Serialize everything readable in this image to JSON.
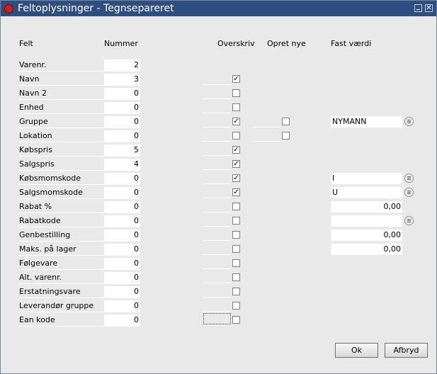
{
  "window": {
    "title": "Feltoplysninger - Tegnsepareret"
  },
  "headers": {
    "felt": "Felt",
    "nummer": "Nummer",
    "overskriv": "Overskriv",
    "opret_nye": "Opret nye",
    "fast_vaerdi": "Fast værdi"
  },
  "rows": [
    {
      "label": "Varenr.",
      "nummer": "2",
      "overskriv": null,
      "opret_nye": null,
      "fast_vaerdi": null,
      "lookup": false
    },
    {
      "label": "Navn",
      "nummer": "3",
      "overskriv": true,
      "opret_nye": null,
      "fast_vaerdi": null,
      "lookup": false
    },
    {
      "label": "Navn 2",
      "nummer": "0",
      "overskriv": false,
      "opret_nye": null,
      "fast_vaerdi": null,
      "lookup": false
    },
    {
      "label": "Enhed",
      "nummer": "0",
      "overskriv": false,
      "opret_nye": null,
      "fast_vaerdi": null,
      "lookup": false
    },
    {
      "label": "Gruppe",
      "nummer": "0",
      "overskriv": true,
      "opret_nye": false,
      "fast_vaerdi": "NYMANN",
      "lookup": true
    },
    {
      "label": "Lokation",
      "nummer": "0",
      "overskriv": false,
      "opret_nye": false,
      "fast_vaerdi": null,
      "lookup": false
    },
    {
      "label": "Købspris",
      "nummer": "5",
      "overskriv": true,
      "opret_nye": null,
      "fast_vaerdi": null,
      "lookup": false
    },
    {
      "label": "Salgspris",
      "nummer": "4",
      "overskriv": true,
      "opret_nye": null,
      "fast_vaerdi": null,
      "lookup": false
    },
    {
      "label": "Købsmomskode",
      "nummer": "0",
      "overskriv": true,
      "opret_nye": null,
      "fast_vaerdi": "I",
      "lookup": true
    },
    {
      "label": "Salgsmomskode",
      "nummer": "0",
      "overskriv": true,
      "opret_nye": null,
      "fast_vaerdi": "U",
      "lookup": true
    },
    {
      "label": "Rabat %",
      "nummer": "0",
      "overskriv": false,
      "opret_nye": null,
      "fast_vaerdi": "0,00",
      "lookup": false
    },
    {
      "label": "Rabatkode",
      "nummer": "0",
      "overskriv": false,
      "opret_nye": null,
      "fast_vaerdi": "",
      "lookup": true
    },
    {
      "label": "Genbestilling",
      "nummer": "0",
      "overskriv": false,
      "opret_nye": null,
      "fast_vaerdi": "0,00",
      "lookup": false
    },
    {
      "label": "Maks. på lager",
      "nummer": "0",
      "overskriv": false,
      "opret_nye": null,
      "fast_vaerdi": "0,00",
      "lookup": false
    },
    {
      "label": "Følgevare",
      "nummer": "0",
      "overskriv": false,
      "opret_nye": null,
      "fast_vaerdi": null,
      "lookup": false
    },
    {
      "label": "Alt. varenr.",
      "nummer": "0",
      "overskriv": false,
      "opret_nye": null,
      "fast_vaerdi": null,
      "lookup": false
    },
    {
      "label": "Erstatningsvare",
      "nummer": "0",
      "overskriv": false,
      "opret_nye": null,
      "fast_vaerdi": null,
      "lookup": false
    },
    {
      "label": "Leverandør gruppe",
      "nummer": "0",
      "overskriv": false,
      "opret_nye": null,
      "fast_vaerdi": null,
      "lookup": false
    },
    {
      "label": "Ean kode",
      "nummer": "0",
      "overskriv": false,
      "opret_nye": null,
      "fast_vaerdi": null,
      "lookup": false
    }
  ],
  "buttons": {
    "ok": "Ok",
    "cancel": "Afbryd"
  },
  "icons": {
    "close": "close-icon",
    "minimize": "minimize-icon",
    "lookup": "list-lookup-icon",
    "app": "red-dot-icon"
  },
  "colors": {
    "titlebar": "#2f4e80",
    "background": "#e9e9e9"
  }
}
